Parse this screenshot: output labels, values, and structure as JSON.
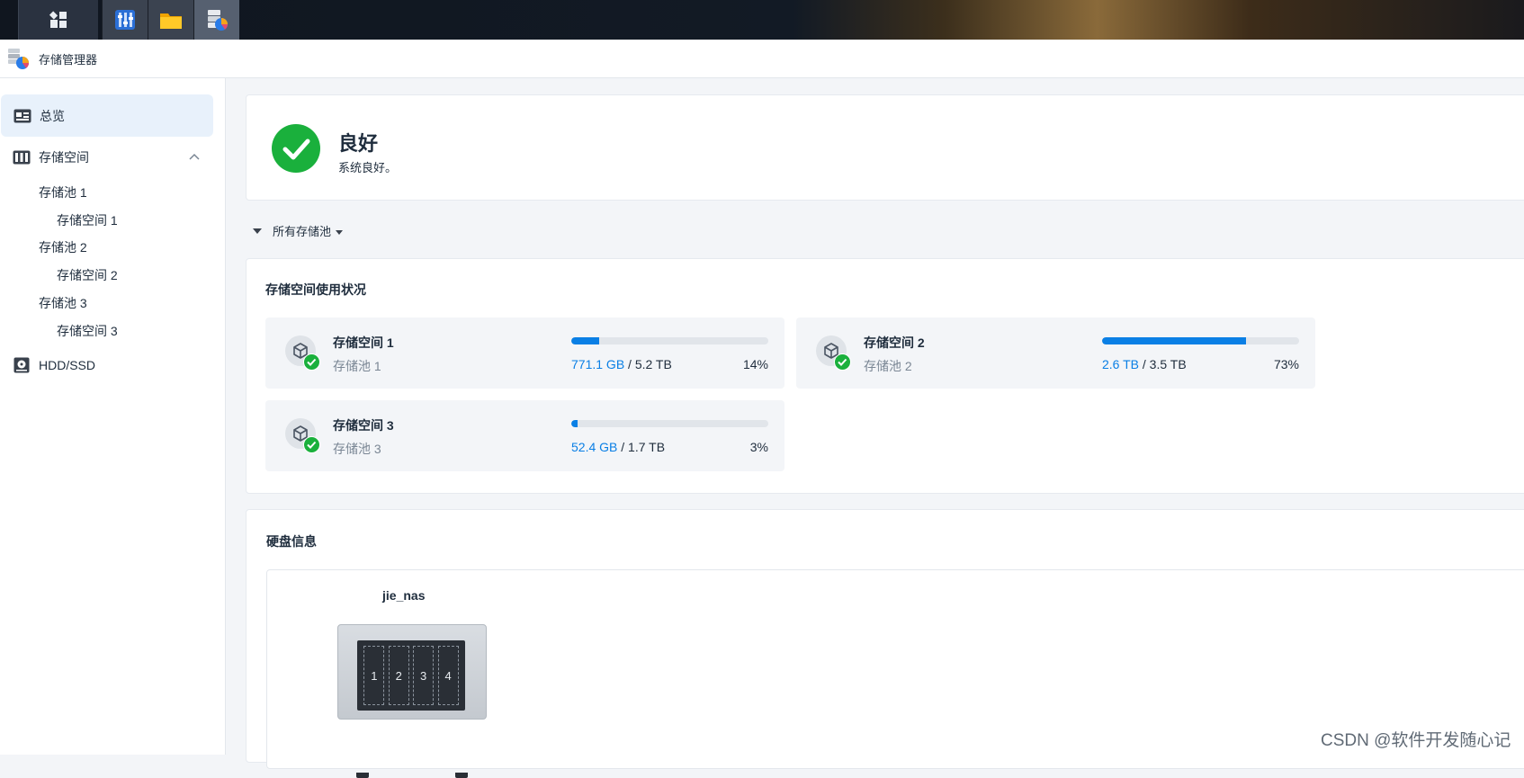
{
  "taskbar": {
    "main_icon": "main-menu-icon",
    "apps": [
      "control-panel-icon",
      "file-station-icon",
      "storage-manager-icon"
    ]
  },
  "titlebar": {
    "app_title": "存储管理器",
    "icon": "storage-manager-icon"
  },
  "sidebar": {
    "items": [
      {
        "label": "总览",
        "icon": "overview-icon",
        "selected": true
      },
      {
        "label": "存储空间",
        "icon": "storage-icon",
        "expanded": true
      },
      {
        "label": "HDD/SSD",
        "icon": "disk-icon"
      }
    ],
    "sub_items": [
      "存储池 1",
      "存储空间 1",
      "存储池 2",
      "存储空间 2",
      "存储池 3",
      "存储空间 3"
    ]
  },
  "status": {
    "title": "良好",
    "desc": "系统良好。",
    "color": "#1ab03c"
  },
  "filter": {
    "label": "所有存储池"
  },
  "usage": {
    "title": "存储空间使用状况",
    "volumes": [
      {
        "name": "存储空间 1",
        "pool": "存储池 1",
        "used": "771.1 GB",
        "sep": "/",
        "total": "5.2 TB",
        "percent": "14%",
        "fraction": 0.14
      },
      {
        "name": "存储空间 2",
        "pool": "存储池 2",
        "used": "2.6 TB",
        "sep": "/",
        "total": "3.5 TB",
        "percent": "73%",
        "fraction": 0.73
      },
      {
        "name": "存储空间 3",
        "pool": "存储池 3",
        "used": "52.4 GB",
        "sep": "/",
        "total": "1.7 TB",
        "percent": "3%",
        "fraction": 0.03
      }
    ]
  },
  "disks": {
    "title": "硬盘信息",
    "nas_name": "jie_nas",
    "bays": [
      "1",
      "2",
      "3",
      "4"
    ]
  },
  "watermark": "CSDN @软件开发随心记",
  "colors": {
    "accent": "#0a7fe5",
    "ok": "#1ab03c",
    "selected_bg": "#e8f1fb"
  }
}
